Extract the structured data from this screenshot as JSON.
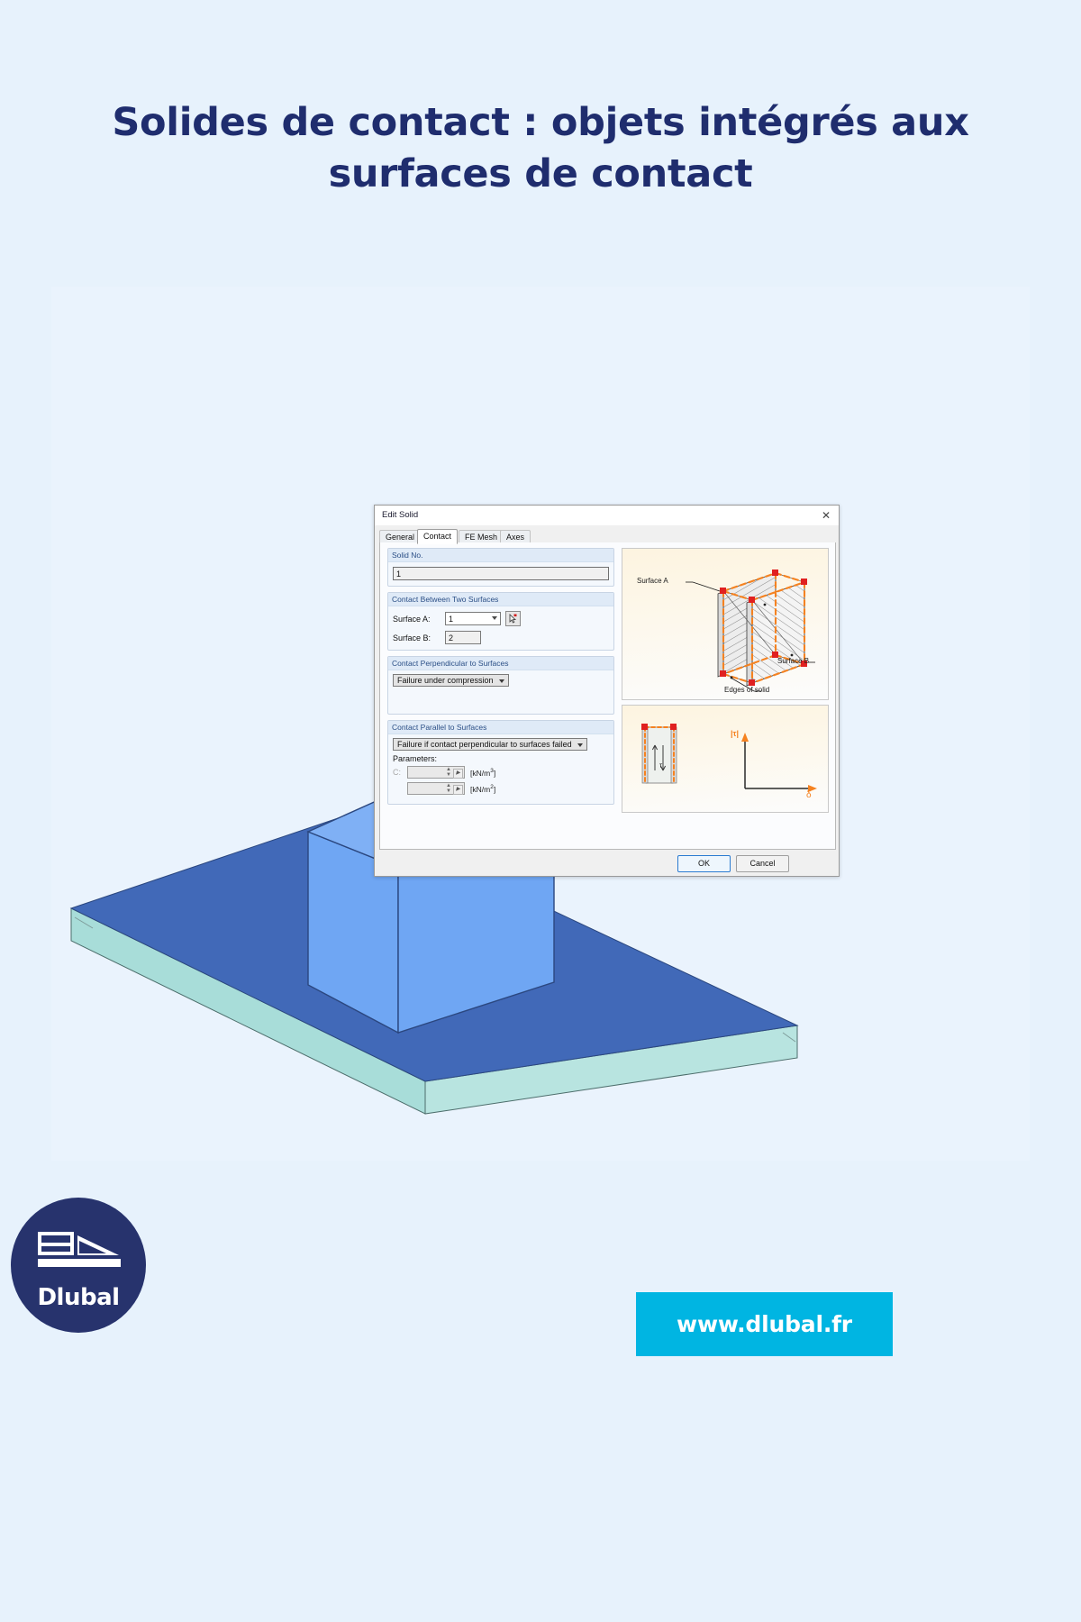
{
  "page": {
    "background_color": "#e7f2fc",
    "title_color": "#1f2d6e"
  },
  "title": {
    "line1": "Solides de contact : objets intégrés aux",
    "line2": "surfaces de contact"
  },
  "dialog": {
    "window_title": "Edit Solid",
    "close_icon": "✕",
    "tabs": [
      {
        "label": "General",
        "active": false
      },
      {
        "label": "Contact",
        "active": true
      },
      {
        "label": "FE Mesh",
        "active": false
      },
      {
        "label": "Axes",
        "active": false
      }
    ],
    "solid_no": {
      "caption": "Solid No.",
      "value": "1"
    },
    "contact_between": {
      "caption": "Contact Between Two Surfaces",
      "surface_a_label": "Surface A:",
      "surface_a_value": "1",
      "surface_b_label": "Surface B:",
      "surface_b_value": "2",
      "pick_icon": "pick-cursor-icon"
    },
    "contact_perpendicular": {
      "caption": "Contact Perpendicular to Surfaces",
      "value": "Failure under compression"
    },
    "contact_parallel": {
      "caption": "Contact Parallel to Surfaces",
      "value": "Failure if contact perpendicular to surfaces failed",
      "parameters_label": "Parameters:",
      "param1_name": "C:",
      "param1_value": "",
      "param1_unit_text": "[kN/m",
      "param1_unit_exp": "3",
      "param2_name": "",
      "param2_value": "",
      "param2_unit_text": "[kN/m",
      "param2_unit_exp": "2"
    },
    "illustration_top": {
      "label_surface_a": "Surface A",
      "label_surface_b": "Surface B",
      "label_edges": "Edges of solid",
      "node_color": "#e02020",
      "edge_color": "#f58220"
    },
    "illustration_bottom": {
      "label_tau": "|τ|",
      "label_delta": "δ",
      "label_tau_small": "τ",
      "axis_color": "#f58220"
    },
    "buttons": {
      "ok": "OK",
      "cancel": "Cancel"
    }
  },
  "model": {
    "description": "3d-contact-solid-on-plate",
    "cube_top_color": "#7fb0f5",
    "cube_front_color": "#6fa6f3",
    "plate_top_color": "#4169b8",
    "plate_side_color": "#a8ddd9"
  },
  "logo": {
    "brand": "Dlubal",
    "mark": "bridge-truss-icon",
    "circle_color": "#27336d"
  },
  "website_button": {
    "label": "www.dlubal.fr",
    "background": "#00b5e2"
  }
}
